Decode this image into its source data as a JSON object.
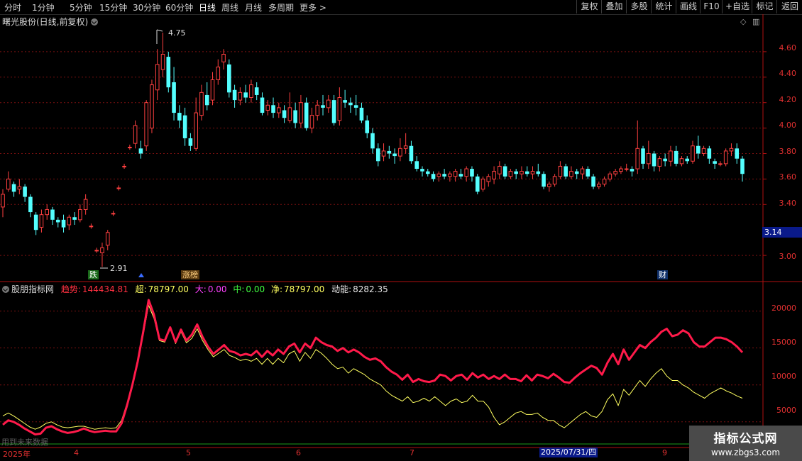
{
  "toolbar": {
    "timeframes": [
      "分时",
      "1分钟",
      "5分钟",
      "15分钟",
      "30分钟",
      "60分钟",
      "日线",
      "周线",
      "月线",
      "多周期",
      "更多 >"
    ],
    "active": "日线",
    "right_buttons": [
      "复权",
      "叠加",
      "多股",
      "统计",
      "画线",
      "F10",
      "+自选",
      "标记",
      "返回"
    ]
  },
  "title": {
    "text": "曙光股份(日线,前复权)"
  },
  "price_axis": {
    "labels": [
      "4.60",
      "4.40",
      "4.20",
      "4.00",
      "3.80",
      "3.60",
      "3.40",
      "3.00"
    ],
    "current": "3.14"
  },
  "markers": {
    "high": "4.75",
    "low": "2.91"
  },
  "tags": {
    "die": "跌",
    "zhangbang": "涨榜",
    "cai": "财"
  },
  "indicator": {
    "name": "股朋指标网",
    "trend_label": "趋势:",
    "trend_value": "144434.81",
    "super_label": "超:",
    "super_value": "78797.00",
    "big_label": "大:",
    "big_value": "0.00",
    "mid_label": "中:",
    "mid_value": "0.00",
    "net_label": "净:",
    "net_value": "78797.00",
    "momentum_label": "动能:",
    "momentum_value": "8282.35",
    "axis": [
      "20000",
      "15000",
      "10000",
      "5000"
    ]
  },
  "footer": {
    "future_note": "用到未来数据",
    "x_labels": [
      "2025年",
      "4",
      "5",
      "6",
      "7",
      "9"
    ],
    "cursor_date": "2025/07/31/四"
  },
  "watermark": {
    "line1": "指标公式网",
    "line2": "www.zbgs3.com"
  },
  "colors": {
    "up": "#ff4040",
    "down": "#54ffff",
    "trend": "#ff1a4a",
    "momentum": "#ffff60"
  },
  "chart_data": [
    {
      "type": "candlestick",
      "title": "曙光股份(日线,前复权)",
      "ylim": [
        2.8,
        4.8
      ],
      "marks": {
        "high": 4.75,
        "low": 2.91,
        "last": 3.14
      },
      "candles": [
        [
          3.38,
          3.48,
          3.3,
          3.52
        ],
        [
          3.52,
          3.6,
          3.5,
          3.66
        ],
        [
          3.56,
          3.5,
          3.46,
          3.58
        ],
        [
          3.52,
          3.54,
          3.48,
          3.6
        ],
        [
          3.54,
          3.46,
          3.42,
          3.56
        ],
        [
          3.46,
          3.34,
          3.3,
          3.48
        ],
        [
          3.32,
          3.2,
          3.16,
          3.34
        ],
        [
          3.22,
          3.32,
          3.18,
          3.36
        ],
        [
          3.32,
          3.36,
          3.28,
          3.4
        ],
        [
          3.36,
          3.28,
          3.24,
          3.38
        ],
        [
          3.28,
          3.26,
          3.22,
          3.3
        ],
        [
          3.28,
          3.22,
          3.18,
          3.32
        ],
        [
          3.24,
          3.3,
          3.2,
          3.32
        ],
        [
          3.3,
          3.28,
          3.24,
          3.34
        ],
        [
          3.28,
          3.36,
          3.26,
          3.4
        ],
        [
          3.36,
          3.44,
          3.32,
          3.48
        ],
        [
          3.23,
          3.23,
          3.21,
          3.25
        ],
        [
          3.04,
          3.04,
          3.02,
          3.06
        ],
        [
          3.02,
          3.06,
          2.91,
          3.1
        ],
        [
          3.08,
          3.18,
          3.04,
          3.2
        ],
        [
          3.33,
          3.33,
          3.31,
          3.35
        ],
        [
          3.53,
          3.53,
          3.51,
          3.55
        ],
        [
          3.7,
          3.7,
          3.68,
          3.72
        ],
        [
          3.85,
          3.85,
          3.83,
          3.87
        ],
        [
          3.88,
          4.02,
          3.84,
          4.06
        ],
        [
          3.84,
          3.8,
          3.76,
          3.9
        ],
        [
          3.86,
          4.2,
          3.82,
          4.22
        ],
        [
          4.0,
          4.34,
          3.96,
          4.38
        ],
        [
          4.3,
          4.5,
          4.22,
          4.62
        ],
        [
          4.46,
          4.58,
          4.4,
          4.75
        ],
        [
          4.56,
          4.32,
          4.28,
          4.6
        ],
        [
          4.36,
          4.12,
          4.06,
          4.48
        ],
        [
          4.12,
          4.06,
          4.0,
          4.18
        ],
        [
          4.1,
          3.92,
          3.86,
          4.16
        ],
        [
          3.92,
          3.86,
          3.82,
          3.96
        ],
        [
          3.84,
          4.12,
          3.82,
          4.24
        ],
        [
          4.1,
          4.28,
          4.06,
          4.34
        ],
        [
          4.26,
          4.18,
          4.14,
          4.36
        ],
        [
          4.22,
          4.38,
          4.18,
          4.44
        ],
        [
          4.38,
          4.48,
          4.34,
          4.54
        ],
        [
          4.52,
          4.58,
          4.46,
          4.62
        ],
        [
          4.5,
          4.28,
          4.24,
          4.54
        ],
        [
          4.3,
          4.22,
          4.16,
          4.34
        ],
        [
          4.22,
          4.28,
          4.18,
          4.32
        ],
        [
          4.28,
          4.24,
          4.2,
          4.34
        ],
        [
          4.24,
          4.34,
          4.2,
          4.38
        ],
        [
          4.32,
          4.26,
          4.22,
          4.36
        ],
        [
          4.24,
          4.12,
          4.1,
          4.28
        ],
        [
          4.14,
          4.18,
          4.1,
          4.22
        ],
        [
          4.18,
          4.12,
          4.08,
          4.24
        ],
        [
          4.12,
          4.16,
          4.08,
          4.2
        ],
        [
          4.14,
          4.08,
          4.04,
          4.18
        ],
        [
          4.06,
          4.16,
          4.04,
          4.28
        ],
        [
          4.14,
          4.04,
          4.0,
          4.2
        ],
        [
          4.04,
          4.2,
          4.0,
          4.26
        ],
        [
          4.2,
          4.0,
          3.98,
          4.24
        ],
        [
          4.0,
          4.1,
          3.96,
          4.16
        ],
        [
          4.1,
          4.18,
          4.06,
          4.22
        ],
        [
          4.18,
          4.16,
          4.1,
          4.26
        ],
        [
          4.16,
          4.22,
          4.12,
          4.26
        ],
        [
          4.22,
          4.04,
          4.02,
          4.26
        ],
        [
          4.06,
          4.24,
          4.02,
          4.32
        ],
        [
          4.22,
          4.2,
          4.16,
          4.3
        ],
        [
          4.2,
          4.18,
          4.12,
          4.24
        ],
        [
          4.18,
          4.16,
          4.1,
          4.26
        ],
        [
          4.16,
          4.06,
          4.04,
          4.2
        ],
        [
          4.06,
          3.96,
          3.92,
          4.1
        ],
        [
          3.96,
          3.84,
          3.8,
          4.0
        ],
        [
          3.84,
          3.74,
          3.7,
          3.88
        ],
        [
          3.78,
          3.82,
          3.74,
          3.88
        ],
        [
          3.82,
          3.8,
          3.76,
          3.86
        ],
        [
          3.8,
          3.78,
          3.72,
          3.84
        ],
        [
          3.78,
          3.84,
          3.74,
          3.92
        ],
        [
          3.84,
          3.86,
          3.8,
          3.96
        ],
        [
          3.86,
          3.74,
          3.72,
          3.9
        ],
        [
          3.74,
          3.68,
          3.66,
          3.78
        ],
        [
          3.68,
          3.66,
          3.62,
          3.7
        ],
        [
          3.66,
          3.64,
          3.62,
          3.68
        ],
        [
          3.64,
          3.6,
          3.58,
          3.66
        ],
        [
          3.62,
          3.64,
          3.58,
          3.66
        ],
        [
          3.64,
          3.62,
          3.6,
          3.68
        ],
        [
          3.62,
          3.64,
          3.58,
          3.66
        ],
        [
          3.62,
          3.66,
          3.58,
          3.68
        ],
        [
          3.64,
          3.62,
          3.6,
          3.68
        ],
        [
          3.62,
          3.68,
          3.58,
          3.7
        ],
        [
          3.68,
          3.62,
          3.58,
          3.7
        ],
        [
          3.62,
          3.5,
          3.48,
          3.64
        ],
        [
          3.52,
          3.6,
          3.5,
          3.62
        ],
        [
          3.58,
          3.62,
          3.54,
          3.64
        ],
        [
          3.6,
          3.66,
          3.56,
          3.7
        ],
        [
          3.64,
          3.7,
          3.6,
          3.74
        ],
        [
          3.7,
          3.62,
          3.6,
          3.72
        ],
        [
          3.62,
          3.66,
          3.6,
          3.68
        ],
        [
          3.66,
          3.64,
          3.6,
          3.68
        ],
        [
          3.64,
          3.66,
          3.6,
          3.7
        ],
        [
          3.66,
          3.64,
          3.62,
          3.7
        ],
        [
          3.64,
          3.66,
          3.6,
          3.7
        ],
        [
          3.66,
          3.64,
          3.62,
          3.72
        ],
        [
          3.64,
          3.54,
          3.52,
          3.66
        ],
        [
          3.54,
          3.56,
          3.5,
          3.58
        ],
        [
          3.56,
          3.62,
          3.54,
          3.64
        ],
        [
          3.62,
          3.7,
          3.6,
          3.74
        ],
        [
          3.7,
          3.62,
          3.6,
          3.72
        ],
        [
          3.62,
          3.66,
          3.6,
          3.7
        ],
        [
          3.66,
          3.64,
          3.6,
          3.68
        ],
        [
          3.64,
          3.68,
          3.6,
          3.7
        ],
        [
          3.68,
          3.62,
          3.6,
          3.7
        ],
        [
          3.62,
          3.54,
          3.52,
          3.64
        ],
        [
          3.54,
          3.56,
          3.52,
          3.58
        ],
        [
          3.56,
          3.6,
          3.54,
          3.62
        ],
        [
          3.6,
          3.64,
          3.58,
          3.66
        ],
        [
          3.64,
          3.66,
          3.62,
          3.68
        ],
        [
          3.66,
          3.68,
          3.64,
          3.7
        ],
        [
          3.68,
          3.68,
          3.66,
          3.72
        ],
        [
          3.68,
          3.66,
          3.62,
          3.7
        ],
        [
          3.68,
          3.84,
          3.64,
          4.06
        ],
        [
          3.84,
          3.72,
          3.68,
          3.86
        ],
        [
          3.72,
          3.8,
          3.68,
          3.9
        ],
        [
          3.8,
          3.7,
          3.66,
          3.82
        ],
        [
          3.7,
          3.76,
          3.66,
          3.78
        ],
        [
          3.76,
          3.74,
          3.7,
          3.8
        ],
        [
          3.74,
          3.82,
          3.7,
          3.86
        ],
        [
          3.82,
          3.72,
          3.7,
          3.86
        ],
        [
          3.72,
          3.76,
          3.7,
          3.78
        ],
        [
          3.76,
          3.74,
          3.72,
          3.78
        ],
        [
          3.74,
          3.86,
          3.72,
          3.9
        ],
        [
          3.86,
          3.8,
          3.76,
          3.94
        ],
        [
          3.8,
          3.84,
          3.78,
          3.86
        ],
        [
          3.84,
          3.76,
          3.72,
          3.86
        ],
        [
          3.74,
          3.72,
          3.68,
          3.76
        ],
        [
          3.72,
          3.72,
          3.7,
          3.74
        ],
        [
          3.72,
          3.82,
          3.7,
          3.84
        ],
        [
          3.82,
          3.84,
          3.78,
          3.88
        ],
        [
          3.84,
          3.76,
          3.72,
          3.88
        ],
        [
          3.76,
          3.64,
          3.58,
          3.78
        ]
      ]
    },
    {
      "type": "line",
      "title": "股朋指标网",
      "ylim": [
        2000,
        24000
      ],
      "series": [
        {
          "name": "趋势",
          "values": [
            4600,
            5200,
            5000,
            4600,
            4100,
            3700,
            3300,
            3400,
            4200,
            4400,
            4000,
            3700,
            3500,
            3600,
            3800,
            4100,
            3800,
            3600,
            3700,
            3800,
            3700,
            3700,
            4800,
            7200,
            10000,
            13200,
            17200,
            21500,
            19500,
            16200,
            16000,
            17800,
            15800,
            17500,
            16000,
            16800,
            18200,
            16500,
            15200,
            14200,
            14800,
            15400,
            14600,
            14400,
            14000,
            14200,
            14000,
            14600,
            13800,
            14600,
            14000,
            14800,
            14200,
            15200,
            15600,
            14400,
            15600,
            15000,
            16400,
            15800,
            15400,
            15200,
            14600,
            15000,
            14400,
            14800,
            14400,
            13800,
            13400,
            13600,
            13200,
            12400,
            11800,
            11400,
            10700,
            11400,
            10400,
            10800,
            10500,
            10400,
            10600,
            11400,
            11200,
            10600,
            11200,
            11400,
            10700,
            11600,
            11000,
            11400,
            10800,
            11200,
            10800,
            11400,
            10800,
            10800,
            10500,
            11300,
            10600,
            11400,
            11200,
            10900,
            11500,
            11000,
            10400,
            10300,
            11000,
            11600,
            12100,
            12600,
            12300,
            11400,
            13000,
            14200,
            12800,
            14800,
            13400,
            14400,
            15400,
            15000,
            15800,
            16400,
            17200,
            17600,
            16600,
            16800,
            17400,
            17000,
            15800,
            15200,
            15200,
            15800,
            16400,
            16400,
            16200,
            15800,
            15200,
            14400
          ]
        },
        {
          "name": "动能",
          "values": [
            5800,
            6200,
            5800,
            5300,
            4800,
            4300,
            4000,
            4300,
            4800,
            5000,
            4600,
            4300,
            4200,
            4300,
            4400,
            4400,
            4200,
            4000,
            4100,
            4200,
            4100,
            4200,
            5200,
            7500,
            10200,
            13000,
            16800,
            20800,
            19000,
            16000,
            15800,
            17600,
            15600,
            17200,
            15700,
            16300,
            17600,
            16000,
            14800,
            13800,
            14300,
            14800,
            14000,
            13700,
            13300,
            13500,
            13200,
            13600,
            12800,
            13600,
            12800,
            13600,
            13000,
            14200,
            14600,
            13200,
            14400,
            13600,
            14800,
            14300,
            13600,
            12800,
            12200,
            12400,
            11600,
            12200,
            11800,
            11400,
            10800,
            10400,
            10000,
            9200,
            8600,
            8200,
            7800,
            8400,
            7600,
            7800,
            8200,
            7800,
            8400,
            7800,
            7200,
            7800,
            8100,
            7600,
            7800,
            8600,
            7800,
            7800,
            7000,
            5600,
            4600,
            5000,
            5600,
            6200,
            6400,
            6000,
            6000,
            6200,
            5600,
            5200,
            5200,
            4600,
            4200,
            4800,
            5400,
            6000,
            6400,
            5800,
            5600,
            6400,
            8000,
            8800,
            7200,
            9400,
            8600,
            9600,
            10600,
            9800,
            10800,
            11600,
            12200,
            11200,
            10600,
            10600,
            10000,
            9600,
            9000,
            8600,
            8200,
            8800,
            9200,
            9600,
            9200,
            8900,
            8500,
            8200
          ]
        }
      ]
    }
  ]
}
